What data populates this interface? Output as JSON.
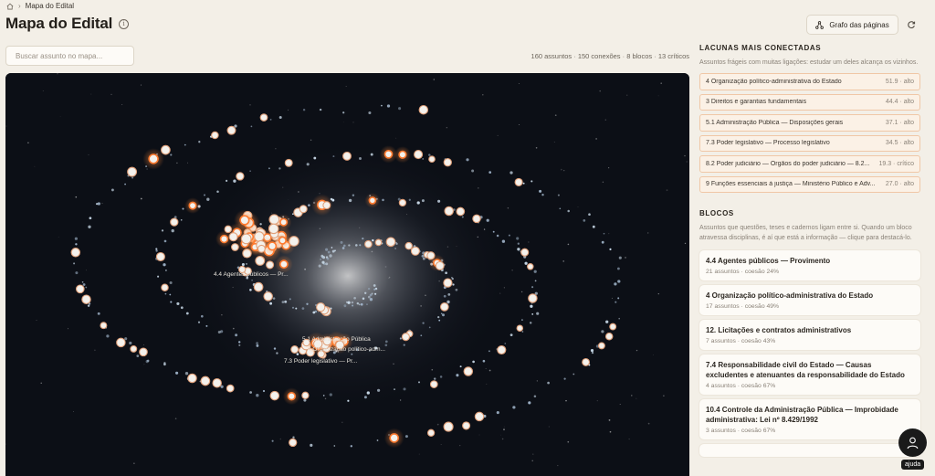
{
  "breadcrumb": {
    "current": "Mapa do Edital"
  },
  "page": {
    "title": "Mapa do Edital"
  },
  "search": {
    "placeholder": "Buscar assunto no mapa..."
  },
  "stats": {
    "assuntos": "160 assuntos",
    "conexoes": "150 conexões",
    "blocos": "8 blocos",
    "criticos": "13 críticos"
  },
  "toolbar": {
    "graph_label": "Grafo das páginas"
  },
  "map": {
    "labels": [
      "4.4 Agentes públicos — Pr...",
      "5.1 Administração Pública",
      "4 Organização político-adm...",
      "7.3 Poder legislativo — Pr..."
    ]
  },
  "lacunas": {
    "heading": "LACUNAS MAIS CONECTADAS",
    "desc": "Assuntos frágeis com muitas ligações: estudar um deles alcança os vizinhos.",
    "items": [
      {
        "label": "4 Organização político-administrativa do Estado",
        "score": "51.9 · alto"
      },
      {
        "label": "3 Direitos e garantias fundamentais",
        "score": "44.4 · alto"
      },
      {
        "label": "5.1 Administração Pública — Disposições gerais",
        "score": "37.1 · alto"
      },
      {
        "label": "7.3 Poder legislativo — Processo legislativo",
        "score": "34.5 · alto"
      },
      {
        "label": "8.2 Poder judiciário — Órgãos do poder judiciário — 8.2...",
        "score": "19.3 · crítico"
      },
      {
        "label": "9 Funções essenciais à justiça — Ministério Público e Adv...",
        "score": "27.0 · alto"
      }
    ]
  },
  "blocos": {
    "heading": "BLOCOS",
    "desc": "Assuntos que questões, teses e cadernos ligam entre si. Quando um bloco atravessa disciplinas, é aí que está a informação — clique para destacá-lo.",
    "items": [
      {
        "title": "4.4 Agentes públicos — Provimento",
        "meta": "21 assuntos · coesão 24%"
      },
      {
        "title": "4 Organização político-administrativa do Estado",
        "meta": "17 assuntos · coesão 49%"
      },
      {
        "title": "12. Licitações e contratos administrativos",
        "meta": "7 assuntos · coesão 43%"
      },
      {
        "title": "7.4 Responsabilidade civil do Estado — Causas excludentes e atenuantes da responsabilidade do Estado",
        "meta": "4 assuntos · coesão 67%"
      },
      {
        "title": "10.4 Controle da Administração Pública — Improbidade administrativa: Lei nº 8.429/1992",
        "meta": "3 assuntos · coesão 67%"
      }
    ]
  },
  "help": {
    "label": "ajuda"
  }
}
